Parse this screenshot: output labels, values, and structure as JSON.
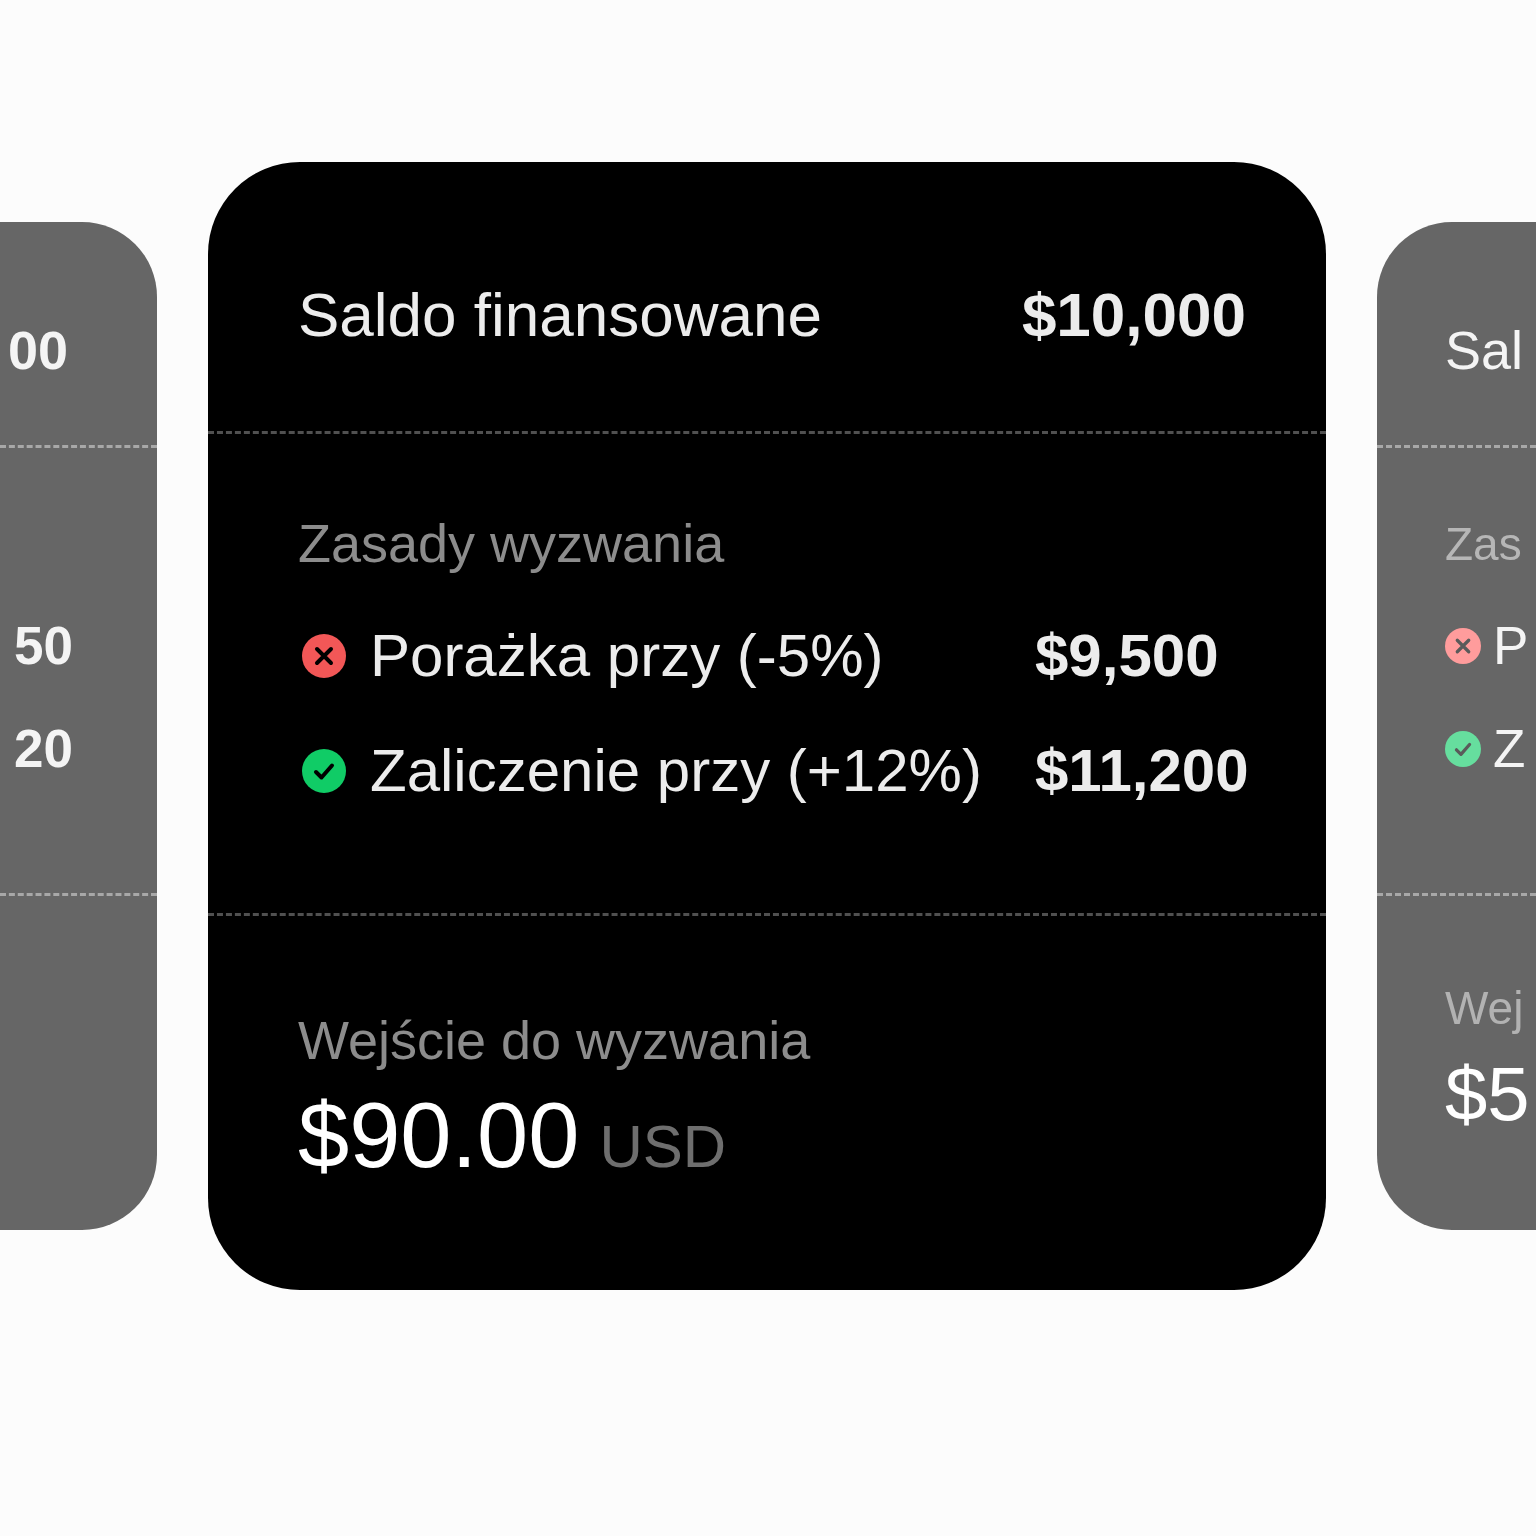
{
  "cards": [
    {
      "selected": false,
      "funded_balance": {
        "value": "00"
      },
      "rules": [
        {
          "value": "50"
        },
        {
          "value": "20"
        }
      ]
    },
    {
      "selected": true,
      "funded_balance": {
        "label": "Saldo finansowane",
        "value": "$10,000"
      },
      "rules_heading": "Zasady wyzwania",
      "rules": [
        {
          "kind": "fail",
          "label": "Porażka przy (-5%)",
          "value": "$9,500"
        },
        {
          "kind": "pass",
          "label": "Zaliczenie przy (+12%)",
          "value": "$11,200"
        }
      ],
      "entry": {
        "label": "Wejście do wyzwania",
        "price": "$90.00",
        "currency": "USD"
      }
    },
    {
      "selected": false,
      "funded_balance": {
        "label": "Sal"
      },
      "rules_heading": "Zas",
      "rules": [
        {
          "kind": "fail",
          "label": "P"
        },
        {
          "kind": "pass",
          "label": "Z"
        }
      ],
      "entry": {
        "label": "Wej",
        "price": "$5"
      }
    }
  ]
}
